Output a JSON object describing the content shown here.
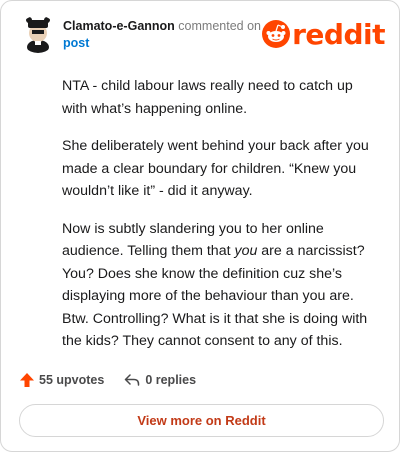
{
  "comment": {
    "author": "Clamato-e-Gannon",
    "action": "commented on",
    "target": "post",
    "brand": "reddit",
    "paragraphs": [
      "NTA - child labour laws really need to catch up with what’s happening online.",
      "She deliberately went behind your back after you made a clear boundary for children. “Knew you wouldn’t like it” - did it anyway."
    ],
    "p3_before": "Now is subtly slandering you to her online audience. Telling them that ",
    "p3_em": "you",
    "p3_after": " are a narcissist? You? Does she know the definition cuz she’s displaying more of the behaviour than you are. Btw. Controlling? What is it that she is doing with the kids? They cannot consent to any of this.",
    "upvotes": "55 upvotes",
    "replies": "0 replies",
    "view_more": "View more on Reddit"
  },
  "colors": {
    "accent": "#ff4500",
    "link": "#0079d3",
    "button_text": "#c23a17"
  }
}
